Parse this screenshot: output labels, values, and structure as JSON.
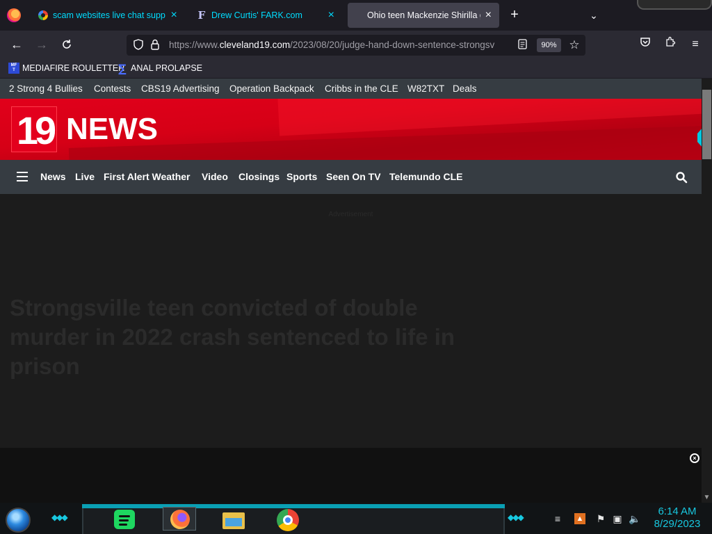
{
  "browser": {
    "tabs": [
      {
        "title": "scam websites live chat support",
        "icon": "google-icon",
        "active": false
      },
      {
        "title": "Drew Curtis' FARK.com",
        "icon": "fark-icon",
        "active": false
      },
      {
        "title": "Ohio teen Mackenzie Shirilla gets",
        "icon": "none",
        "active": true
      }
    ],
    "url_prefix": "https://www.",
    "url_host": "cleveland19.com",
    "url_path": "/2023/08/20/judge-hand-down-sentence-strongsv",
    "zoom": "90%",
    "bookmarks": [
      {
        "label": "MEDIAFIRE ROULETTER",
        "icon_text": "MF T"
      },
      {
        "label": "ANAL PROLAPSE",
        "icon_text": "∑"
      }
    ]
  },
  "site": {
    "top_links": [
      "2 Strong 4 Bullies",
      "Contests",
      "CBS19 Advertising",
      "Operation Backpack",
      "Cribbs in the CLE",
      "W82TXT",
      "Deals"
    ],
    "logo_number": "19",
    "logo_word": "NEWS",
    "main_nav": [
      "News",
      "Live",
      "First Alert Weather",
      "Video",
      "Closings",
      "Sports",
      "Seen On TV",
      "Telemundo CLE"
    ],
    "ad_label": "Advertisement",
    "headline": "Strongsville teen convicted of double murder in 2022 crash sentenced to life in prison",
    "colors": {
      "brand_red": "#e1001b",
      "nav_bg": "#363c42"
    }
  },
  "taskbar": {
    "time": "6:14 AM",
    "date": "8/29/2023",
    "apps": [
      "spotify-icon",
      "firefox-icon",
      "file-explorer-icon",
      "chrome-icon"
    ],
    "accent": "#18c8e0"
  }
}
